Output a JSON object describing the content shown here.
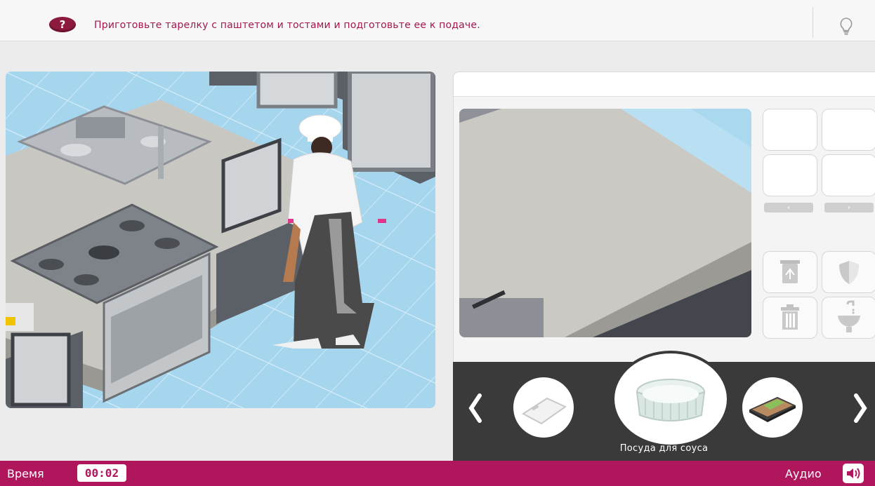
{
  "header": {
    "help_icon": "question-icon",
    "instruction": "Приготовьте тарелку с паштетом и тостами и подготовьте ее к подаче.",
    "hint_icon": "lightbulb-icon",
    "help_glyph": "?"
  },
  "scene": {
    "kitchen_view": "chef-in-kitchen",
    "counter_view": "empty-counter"
  },
  "tools": {
    "pager_prev": "‹",
    "pager_next": "›",
    "items": [
      "recycle-bin-icon",
      "shield-icon",
      "trash-can-icon",
      "sink-tap-icon"
    ]
  },
  "carousel": {
    "prev_icon": "chevron-left-icon",
    "next_icon": "chevron-right-icon",
    "items": [
      {
        "icon": "cutting-board-icon"
      },
      {
        "icon": "sauce-dish-icon",
        "label": "Посуда для соуса",
        "selected": true
      },
      {
        "icon": "pate-tray-icon"
      }
    ]
  },
  "footer": {
    "time_label": "Время",
    "time_value": "00:02",
    "audio_label": "Аудио",
    "audio_icon": "speaker-icon"
  },
  "colors": {
    "brand": "#b0165c",
    "instruction_text": "#a3174f",
    "help_icon": "#8b1a3c",
    "carousel_bg": "#3a3a3a"
  }
}
